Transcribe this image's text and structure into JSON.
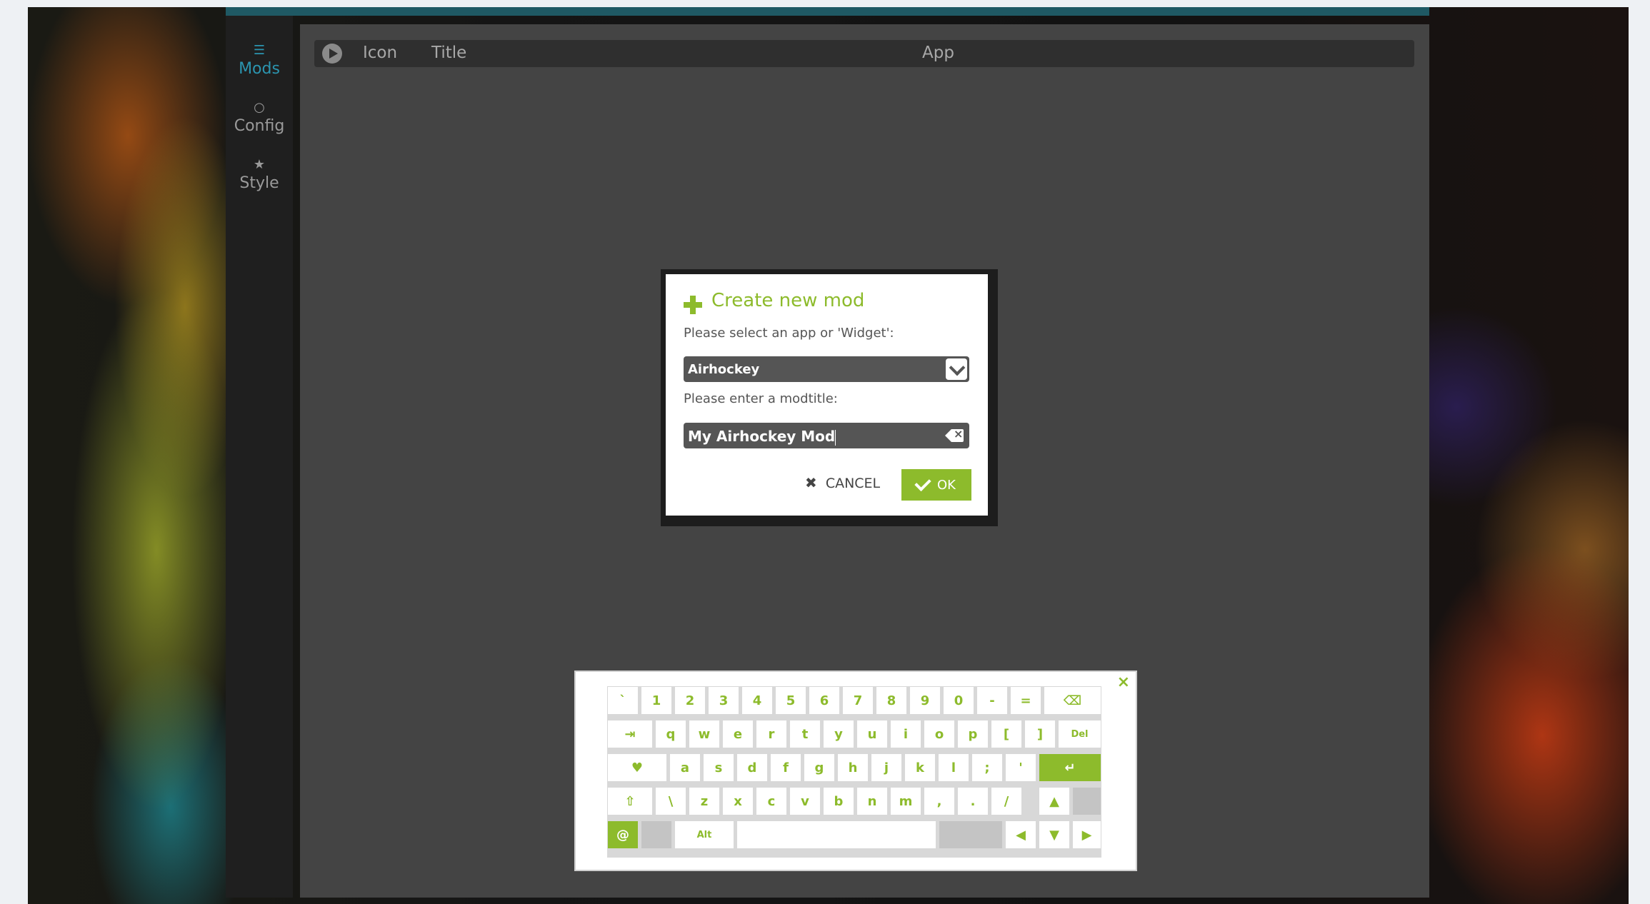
{
  "sidebar": {
    "items": [
      {
        "label": "Mods",
        "icon": "list-icon",
        "active": true
      },
      {
        "label": "Config",
        "icon": "gear-icon",
        "active": false
      },
      {
        "label": "Style",
        "icon": "star-icon",
        "active": false
      }
    ]
  },
  "table_header": {
    "icon": "Icon",
    "title": "Title",
    "app": "App"
  },
  "dialog": {
    "title": "Create new mod",
    "select_label": "Please select an app or 'Widget':",
    "select_value": "Airhockey",
    "title_label": "Please enter a modtitle:",
    "title_value": "My Airhockey Mod",
    "cancel_label": "CANCEL",
    "ok_label": "OK"
  },
  "keyboard": {
    "close": "×",
    "row1": [
      "`",
      "1",
      "2",
      "3",
      "4",
      "5",
      "6",
      "7",
      "8",
      "9",
      "0",
      "-",
      "=",
      "⌫"
    ],
    "row2": [
      "⇥",
      "q",
      "w",
      "e",
      "r",
      "t",
      "y",
      "u",
      "i",
      "o",
      "p",
      "[",
      "]",
      "Del"
    ],
    "row3": [
      "♥",
      "a",
      "s",
      "d",
      "f",
      "g",
      "h",
      "j",
      "k",
      "l",
      ";",
      "'",
      "↵"
    ],
    "row4": [
      "⇧",
      "\\",
      "z",
      "x",
      "c",
      "v",
      "b",
      "n",
      "m",
      ",",
      ".",
      "/",
      "▲"
    ],
    "row5": {
      "at": "@",
      "alt": "Alt",
      "left": "◀",
      "down": "▼",
      "right": "▶"
    }
  },
  "colors": {
    "accent": "#8dbb2c",
    "active_tab": "#2b95b0",
    "panel": "#444444"
  }
}
